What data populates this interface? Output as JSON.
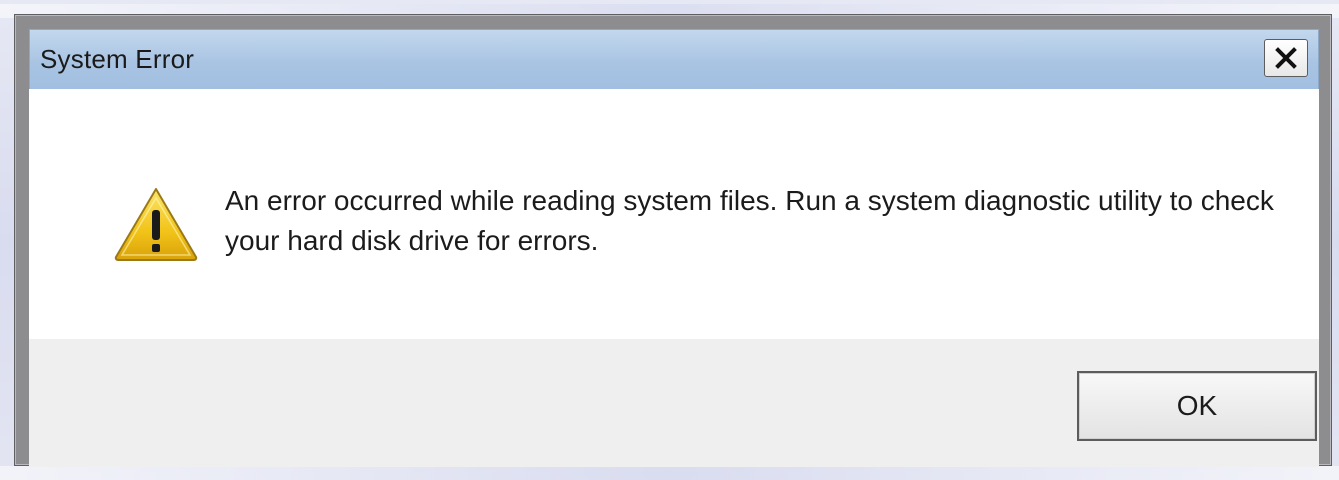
{
  "dialog": {
    "title": "System Error",
    "message": "An error occurred while reading system files. Run a system diagnostic utility to check your hard disk drive for errors.",
    "icon": "warning-icon",
    "buttons": {
      "ok_label": "OK",
      "close_icon": "close-icon"
    }
  },
  "colors": {
    "titlebar": "#a9c4e3",
    "content_background": "#ffffff",
    "footer_background": "#efefef",
    "warning_fill": "#f2c318",
    "window_frame": "#8d8d8f"
  }
}
